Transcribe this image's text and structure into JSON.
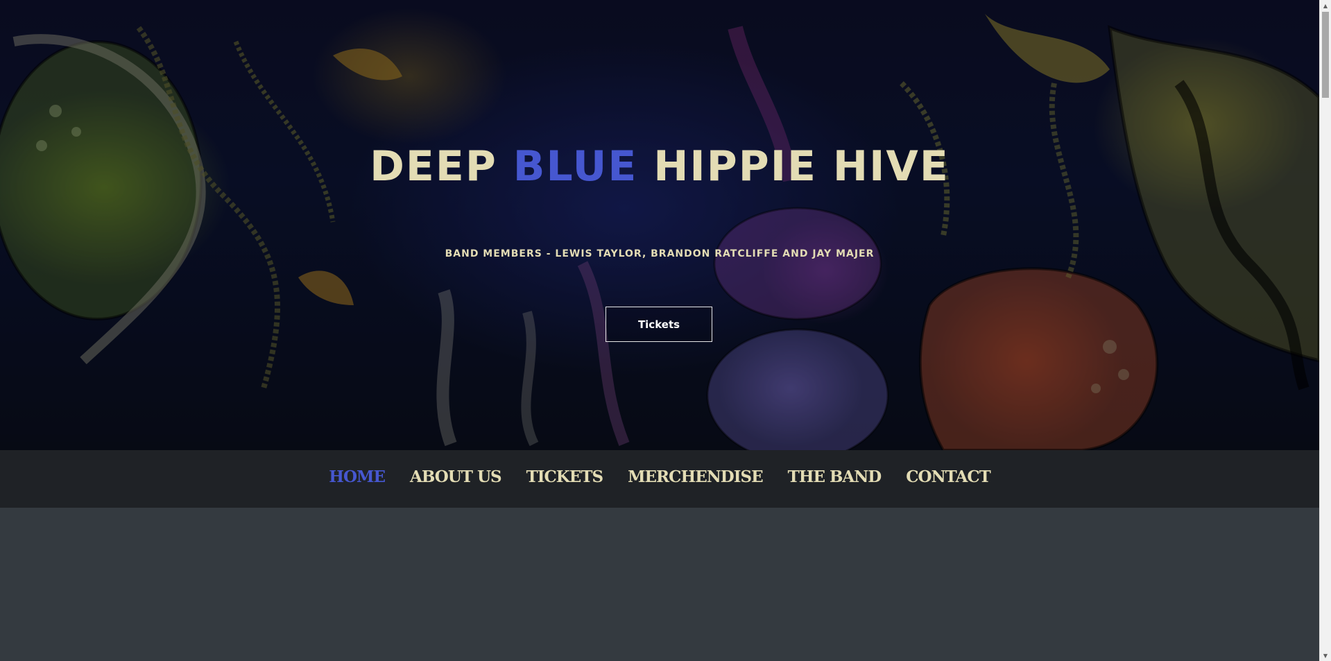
{
  "hero": {
    "title_part1": "DEEP ",
    "title_accent": "BLUE",
    "title_part2": " HIPPIE HIVE",
    "subtitle": "BAND MEMBERS - LEWIS TAYLOR, BRANDON RATCLIFFE AND JAY MAJER",
    "cta_label": "Tickets"
  },
  "nav": {
    "items": [
      {
        "label": "HOME",
        "active": true
      },
      {
        "label": "ABOUT US",
        "active": false
      },
      {
        "label": "TICKETS",
        "active": false
      },
      {
        "label": "MERCHENDISE",
        "active": false
      },
      {
        "label": "THE BAND",
        "active": false
      },
      {
        "label": "CONTACT",
        "active": false
      }
    ]
  },
  "colors": {
    "accent": "#4657d0",
    "title": "#e3dcb4",
    "nav_bg": "#1f2226",
    "content_bg": "#343a40"
  }
}
